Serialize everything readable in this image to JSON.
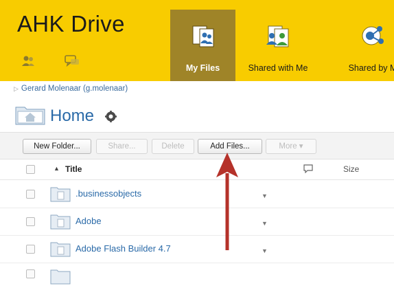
{
  "header": {
    "app_title": "AHK Drive",
    "icons": [
      "users-icon",
      "chat-icon"
    ],
    "nav": [
      {
        "label": "My Files",
        "icon": "my-files-icon",
        "active": true
      },
      {
        "label": "Shared with Me",
        "icon": "shared-with-me-icon",
        "active": false
      },
      {
        "label": "Shared by M",
        "icon": "shared-by-me-icon",
        "active": false
      }
    ]
  },
  "breadcrumb": {
    "text": "Gerard Molenaar (g.molenaar)"
  },
  "page": {
    "title": "Home"
  },
  "toolbar": {
    "new_folder": "New Folder...",
    "share": "Share...",
    "delete": "Delete",
    "add_files": "Add Files...",
    "more": "More ▾"
  },
  "table": {
    "columns": {
      "title": "Title",
      "size": "Size"
    },
    "sort_indicator": "▲",
    "rows": [
      {
        "name": ".businessobjects"
      },
      {
        "name": "Adobe"
      },
      {
        "name": "Adobe Flash Builder 4.7"
      }
    ]
  },
  "colors": {
    "header_bg": "#f8cc00",
    "active_tab": "#9f8428",
    "link": "#2a6aa8",
    "annotation_arrow": "#b5322a"
  }
}
